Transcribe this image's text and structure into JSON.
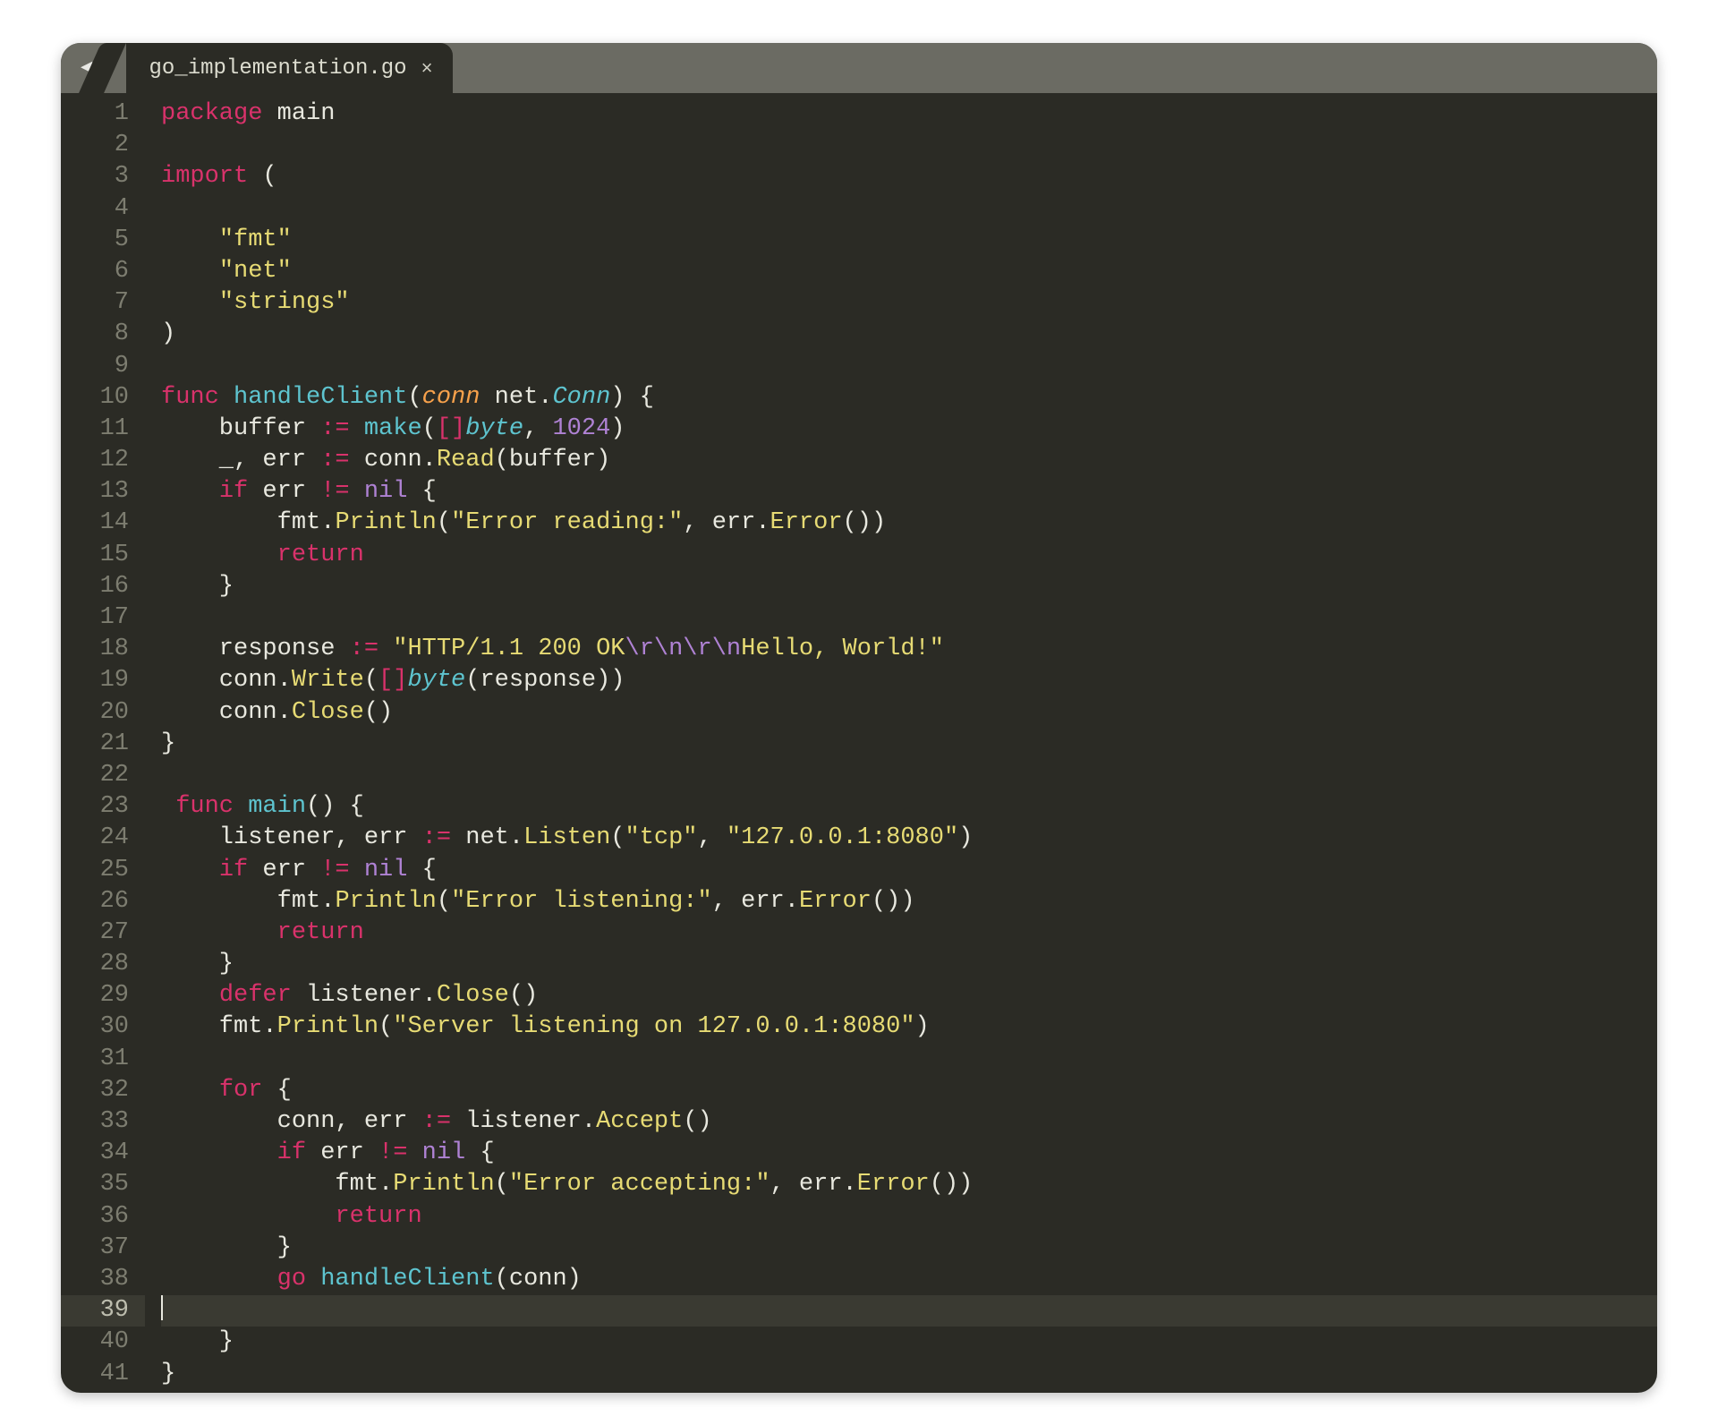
{
  "tab": {
    "filename": "go_implementation.go",
    "close_glyph": "×"
  },
  "nav": {
    "back": "◀",
    "forward": "▶"
  },
  "active_line": 39,
  "code": {
    "lines": [
      [
        {
          "t": "package ",
          "c": "c-kw"
        },
        {
          "t": "main",
          "c": "c-id"
        }
      ],
      [],
      [
        {
          "t": "import ",
          "c": "c-kw"
        },
        {
          "t": "(",
          "c": "c-id"
        }
      ],
      [],
      [
        {
          "t": "    ",
          "c": ""
        },
        {
          "t": "\"fmt\"",
          "c": "c-str"
        }
      ],
      [
        {
          "t": "    ",
          "c": ""
        },
        {
          "t": "\"net\"",
          "c": "c-str"
        }
      ],
      [
        {
          "t": "    ",
          "c": ""
        },
        {
          "t": "\"strings\"",
          "c": "c-str"
        }
      ],
      [
        {
          "t": ")",
          "c": "c-id"
        }
      ],
      [],
      [
        {
          "t": "func ",
          "c": "c-kw"
        },
        {
          "t": "handleClient",
          "c": "c-func"
        },
        {
          "t": "(",
          "c": "c-id"
        },
        {
          "t": "conn",
          "c": "c-param"
        },
        {
          "t": " ",
          "c": ""
        },
        {
          "t": "net",
          "c": "c-id"
        },
        {
          "t": ".",
          "c": "c-id"
        },
        {
          "t": "Conn",
          "c": "c-type"
        },
        {
          "t": ") {",
          "c": "c-id"
        }
      ],
      [
        {
          "t": "    buffer ",
          "c": "c-id"
        },
        {
          "t": ":=",
          "c": "c-op"
        },
        {
          "t": " ",
          "c": ""
        },
        {
          "t": "make",
          "c": "c-builtin"
        },
        {
          "t": "(",
          "c": "c-id"
        },
        {
          "t": "[]",
          "c": "c-op"
        },
        {
          "t": "byte",
          "c": "c-type"
        },
        {
          "t": ", ",
          "c": "c-id"
        },
        {
          "t": "1024",
          "c": "c-num"
        },
        {
          "t": ")",
          "c": "c-id"
        }
      ],
      [
        {
          "t": "    _",
          "c": "c-id"
        },
        {
          "t": ", err ",
          "c": "c-id"
        },
        {
          "t": ":=",
          "c": "c-op"
        },
        {
          "t": " conn.",
          "c": "c-id"
        },
        {
          "t": "Read",
          "c": "c-funcY"
        },
        {
          "t": "(buffer)",
          "c": "c-id"
        }
      ],
      [
        {
          "t": "    ",
          "c": ""
        },
        {
          "t": "if",
          "c": "c-kw"
        },
        {
          "t": " err ",
          "c": "c-id"
        },
        {
          "t": "!=",
          "c": "c-op"
        },
        {
          "t": " ",
          "c": ""
        },
        {
          "t": "nil",
          "c": "c-num"
        },
        {
          "t": " {",
          "c": "c-id"
        }
      ],
      [
        {
          "t": "        fmt.",
          "c": "c-id"
        },
        {
          "t": "Println",
          "c": "c-funcY"
        },
        {
          "t": "(",
          "c": "c-id"
        },
        {
          "t": "\"Error reading:\"",
          "c": "c-str"
        },
        {
          "t": ", err.",
          "c": "c-id"
        },
        {
          "t": "Error",
          "c": "c-funcY"
        },
        {
          "t": "())",
          "c": "c-id"
        }
      ],
      [
        {
          "t": "        ",
          "c": ""
        },
        {
          "t": "return",
          "c": "c-kw"
        }
      ],
      [
        {
          "t": "    }",
          "c": "c-id"
        }
      ],
      [],
      [
        {
          "t": "    response ",
          "c": "c-id"
        },
        {
          "t": ":=",
          "c": "c-op"
        },
        {
          "t": " ",
          "c": ""
        },
        {
          "t": "\"HTTP/1.1 200 OK",
          "c": "c-str"
        },
        {
          "t": "\\r\\n\\r\\n",
          "c": "c-esc"
        },
        {
          "t": "Hello, World!\"",
          "c": "c-str"
        }
      ],
      [
        {
          "t": "    conn.",
          "c": "c-id"
        },
        {
          "t": "Write",
          "c": "c-funcY"
        },
        {
          "t": "(",
          "c": "c-id"
        },
        {
          "t": "[]",
          "c": "c-op"
        },
        {
          "t": "byte",
          "c": "c-type"
        },
        {
          "t": "(response))",
          "c": "c-id"
        }
      ],
      [
        {
          "t": "    conn.",
          "c": "c-id"
        },
        {
          "t": "Close",
          "c": "c-funcY"
        },
        {
          "t": "()",
          "c": "c-id"
        }
      ],
      [
        {
          "t": "}",
          "c": "c-id"
        }
      ],
      [],
      [
        {
          "t": " ",
          "c": ""
        },
        {
          "t": "func ",
          "c": "c-kw"
        },
        {
          "t": "main",
          "c": "c-func"
        },
        {
          "t": "() {",
          "c": "c-id"
        }
      ],
      [
        {
          "t": "    listener, err ",
          "c": "c-id"
        },
        {
          "t": ":=",
          "c": "c-op"
        },
        {
          "t": " net.",
          "c": "c-id"
        },
        {
          "t": "Listen",
          "c": "c-funcY"
        },
        {
          "t": "(",
          "c": "c-id"
        },
        {
          "t": "\"tcp\"",
          "c": "c-str"
        },
        {
          "t": ", ",
          "c": "c-id"
        },
        {
          "t": "\"127.0.0.1:8080\"",
          "c": "c-str"
        },
        {
          "t": ")",
          "c": "c-id"
        }
      ],
      [
        {
          "t": "    ",
          "c": ""
        },
        {
          "t": "if",
          "c": "c-kw"
        },
        {
          "t": " err ",
          "c": "c-id"
        },
        {
          "t": "!=",
          "c": "c-op"
        },
        {
          "t": " ",
          "c": ""
        },
        {
          "t": "nil",
          "c": "c-num"
        },
        {
          "t": " {",
          "c": "c-id"
        }
      ],
      [
        {
          "t": "        fmt.",
          "c": "c-id"
        },
        {
          "t": "Println",
          "c": "c-funcY"
        },
        {
          "t": "(",
          "c": "c-id"
        },
        {
          "t": "\"Error listening:\"",
          "c": "c-str"
        },
        {
          "t": ", err.",
          "c": "c-id"
        },
        {
          "t": "Error",
          "c": "c-funcY"
        },
        {
          "t": "())",
          "c": "c-id"
        }
      ],
      [
        {
          "t": "        ",
          "c": ""
        },
        {
          "t": "return",
          "c": "c-kw"
        }
      ],
      [
        {
          "t": "    }",
          "c": "c-id"
        }
      ],
      [
        {
          "t": "    ",
          "c": ""
        },
        {
          "t": "defer",
          "c": "c-kw"
        },
        {
          "t": " listener.",
          "c": "c-id"
        },
        {
          "t": "Close",
          "c": "c-funcY"
        },
        {
          "t": "()",
          "c": "c-id"
        }
      ],
      [
        {
          "t": "    fmt.",
          "c": "c-id"
        },
        {
          "t": "Println",
          "c": "c-funcY"
        },
        {
          "t": "(",
          "c": "c-id"
        },
        {
          "t": "\"Server listening on 127.0.0.1:8080\"",
          "c": "c-str"
        },
        {
          "t": ")",
          "c": "c-id"
        }
      ],
      [],
      [
        {
          "t": "    ",
          "c": ""
        },
        {
          "t": "for",
          "c": "c-kw"
        },
        {
          "t": " {",
          "c": "c-id"
        }
      ],
      [
        {
          "t": "        conn, err ",
          "c": "c-id"
        },
        {
          "t": ":=",
          "c": "c-op"
        },
        {
          "t": " listener.",
          "c": "c-id"
        },
        {
          "t": "Accept",
          "c": "c-funcY"
        },
        {
          "t": "()",
          "c": "c-id"
        }
      ],
      [
        {
          "t": "        ",
          "c": ""
        },
        {
          "t": "if",
          "c": "c-kw"
        },
        {
          "t": " err ",
          "c": "c-id"
        },
        {
          "t": "!=",
          "c": "c-op"
        },
        {
          "t": " ",
          "c": ""
        },
        {
          "t": "nil",
          "c": "c-num"
        },
        {
          "t": " {",
          "c": "c-id"
        }
      ],
      [
        {
          "t": "            fmt.",
          "c": "c-id"
        },
        {
          "t": "Println",
          "c": "c-funcY"
        },
        {
          "t": "(",
          "c": "c-id"
        },
        {
          "t": "\"Error accepting:\"",
          "c": "c-str"
        },
        {
          "t": ", err.",
          "c": "c-id"
        },
        {
          "t": "Error",
          "c": "c-funcY"
        },
        {
          "t": "())",
          "c": "c-id"
        }
      ],
      [
        {
          "t": "            ",
          "c": ""
        },
        {
          "t": "return",
          "c": "c-kw"
        }
      ],
      [
        {
          "t": "        }",
          "c": "c-id"
        }
      ],
      [
        {
          "t": "        ",
          "c": ""
        },
        {
          "t": "go",
          "c": "c-kw"
        },
        {
          "t": " ",
          "c": ""
        },
        {
          "t": "handleClient",
          "c": "c-func"
        },
        {
          "t": "(conn)",
          "c": "c-id"
        }
      ],
      [],
      [
        {
          "t": "    }",
          "c": "c-id"
        }
      ],
      [
        {
          "t": "}",
          "c": "c-id"
        }
      ]
    ]
  }
}
